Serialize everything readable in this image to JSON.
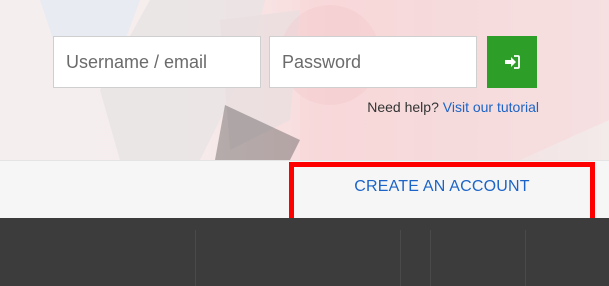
{
  "login": {
    "username_placeholder": "Username / email",
    "password_placeholder": "Password",
    "submit_icon": "sign-in-icon"
  },
  "help": {
    "prefix": "Need help?",
    "link": "Visit our tutorial"
  },
  "account_bar": {
    "create_label": "CREATE AN ACCOUNT"
  },
  "colors": {
    "accent_green": "#2d9e28",
    "link_blue": "#1c64c7",
    "highlight_red": "#ff0000",
    "footer_dark": "#3c3c3c"
  }
}
